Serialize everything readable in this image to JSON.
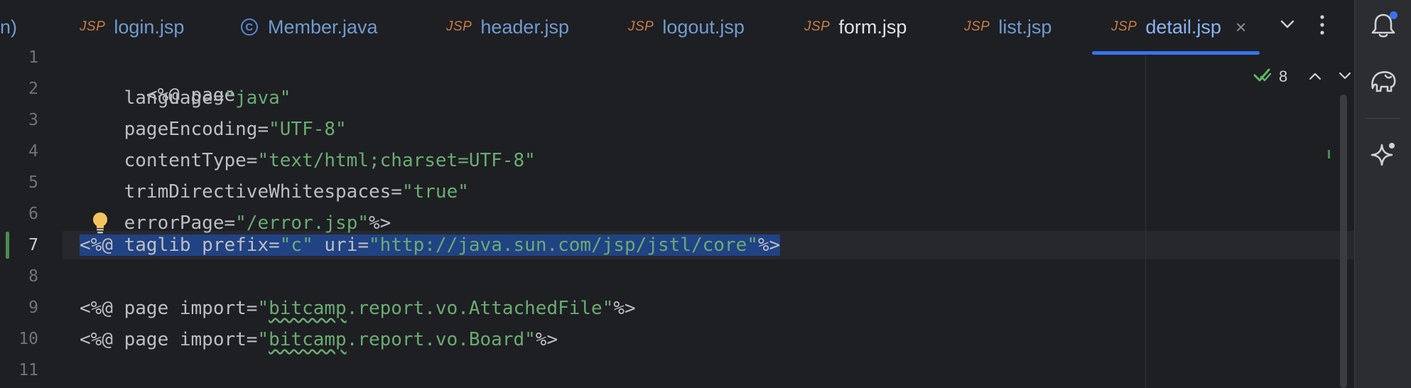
{
  "tabs": {
    "partial_label": "n)",
    "items": [
      {
        "label": "login.jsp",
        "icon": "JSP",
        "type": "jsp"
      },
      {
        "label": "Member.java",
        "icon": "C",
        "type": "java"
      },
      {
        "label": "header.jsp",
        "icon": "JSP",
        "type": "jsp"
      },
      {
        "label": "logout.jsp",
        "icon": "JSP",
        "type": "jsp"
      },
      {
        "label": "form.jsp",
        "icon": "JSP",
        "type": "jsp"
      },
      {
        "label": "list.jsp",
        "icon": "JSP",
        "type": "jsp"
      },
      {
        "label": "detail.jsp",
        "icon": "JSP",
        "type": "jsp",
        "selected": true
      }
    ],
    "close_glyph": "×"
  },
  "inspection": {
    "count": "8"
  },
  "editor": {
    "current_line": 7,
    "line_numbers": [
      "1",
      "2",
      "3",
      "4",
      "5",
      "6",
      "7",
      "8",
      "9",
      "10",
      "11"
    ],
    "lines": {
      "l1": {
        "text": "<%@ page"
      },
      "l2": {
        "attr": "    language=",
        "value": "\"java\""
      },
      "l3": {
        "attr": "    pageEncoding=",
        "value": "\"UTF-8\""
      },
      "l4": {
        "attr": "    contentType=",
        "value": "\"text/html;charset=UTF-8\""
      },
      "l5": {
        "attr": "    trimDirectiveWhitespaces=",
        "value": "\"true\""
      },
      "l6": {
        "attr": "    errorPage=",
        "value": "\"/error.jsp\"",
        "close": "%>"
      },
      "l7": {
        "t1": "<%@ taglib prefix=",
        "v1": "\"c\"",
        "t2": " uri=",
        "v2": "\"http://java.sun.com/jsp/jstl/core\"",
        "close": "%>"
      },
      "l9": {
        "t1": "<%@ page import=",
        "q1": "\"",
        "word": "bitcamp",
        "rest": ".report.vo.AttachedFile\"",
        "close": "%>"
      },
      "l10": {
        "t1": "<%@ page import=",
        "q1": "\"",
        "word": "bitcamp",
        "rest": ".report.vo.Board\"",
        "close": "%>"
      }
    }
  },
  "colors": {
    "background": "#1e1f22",
    "string": "#6aab73",
    "selection": "#214283",
    "accent": "#3574f0"
  }
}
